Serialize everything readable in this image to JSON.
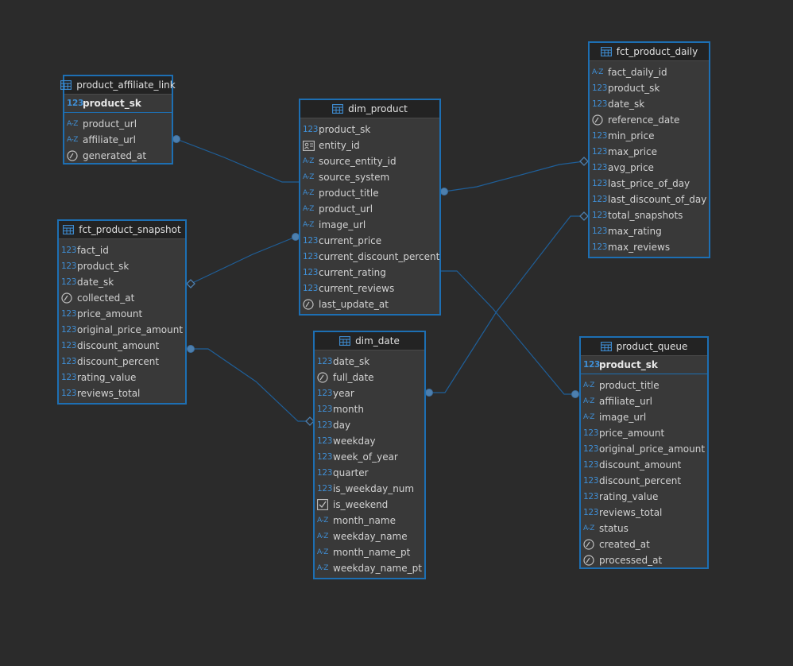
{
  "icons": {
    "number": "123",
    "text": "A-Z",
    "table": "table-icon",
    "date": "clock-icon",
    "identity": "id-card-icon",
    "boolean": "checkbox-icon"
  },
  "colors": {
    "background": "#2b2b2b",
    "border": "#1d6fb3",
    "header": "#232323",
    "connector": "#1f5f99",
    "type_icon": "#3f8fd6"
  },
  "tables": [
    {
      "id": "product_affiliate_link",
      "name": "product_affiliate_link",
      "pk": {
        "name": "product_sk",
        "type": "number"
      },
      "columns": [
        {
          "name": "product_url",
          "type": "text"
        },
        {
          "name": "affiliate_url",
          "type": "text"
        },
        {
          "name": "generated_at",
          "type": "date"
        }
      ]
    },
    {
      "id": "dim_product",
      "name": "dim_product",
      "pk": null,
      "columns": [
        {
          "name": "product_sk",
          "type": "number"
        },
        {
          "name": "entity_id",
          "type": "identity"
        },
        {
          "name": "source_entity_id",
          "type": "text"
        },
        {
          "name": "source_system",
          "type": "text"
        },
        {
          "name": "product_title",
          "type": "text"
        },
        {
          "name": "product_url",
          "type": "text"
        },
        {
          "name": "image_url",
          "type": "text"
        },
        {
          "name": "current_price",
          "type": "number"
        },
        {
          "name": "current_discount_percent",
          "type": "number"
        },
        {
          "name": "current_rating",
          "type": "number"
        },
        {
          "name": "current_reviews",
          "type": "number"
        },
        {
          "name": "last_update_at",
          "type": "date"
        }
      ]
    },
    {
      "id": "fct_product_daily",
      "name": "fct_product_daily",
      "pk": null,
      "columns": [
        {
          "name": "fact_daily_id",
          "type": "text"
        },
        {
          "name": "product_sk",
          "type": "number"
        },
        {
          "name": "date_sk",
          "type": "number"
        },
        {
          "name": "reference_date",
          "type": "date"
        },
        {
          "name": "min_price",
          "type": "number"
        },
        {
          "name": "max_price",
          "type": "number"
        },
        {
          "name": "avg_price",
          "type": "number"
        },
        {
          "name": "last_price_of_day",
          "type": "number"
        },
        {
          "name": "last_discount_of_day",
          "type": "number"
        },
        {
          "name": "total_snapshots",
          "type": "number"
        },
        {
          "name": "max_rating",
          "type": "number"
        },
        {
          "name": "max_reviews",
          "type": "number"
        }
      ]
    },
    {
      "id": "fct_product_snapshot",
      "name": "fct_product_snapshot",
      "pk": null,
      "columns": [
        {
          "name": "fact_id",
          "type": "number"
        },
        {
          "name": "product_sk",
          "type": "number"
        },
        {
          "name": "date_sk",
          "type": "number"
        },
        {
          "name": "collected_at",
          "type": "date"
        },
        {
          "name": "price_amount",
          "type": "number"
        },
        {
          "name": "original_price_amount",
          "type": "number"
        },
        {
          "name": "discount_amount",
          "type": "number"
        },
        {
          "name": "discount_percent",
          "type": "number"
        },
        {
          "name": "rating_value",
          "type": "number"
        },
        {
          "name": "reviews_total",
          "type": "number"
        }
      ]
    },
    {
      "id": "dim_date",
      "name": "dim_date",
      "pk": null,
      "columns": [
        {
          "name": "date_sk",
          "type": "number"
        },
        {
          "name": "full_date",
          "type": "date"
        },
        {
          "name": "year",
          "type": "number"
        },
        {
          "name": "month",
          "type": "number"
        },
        {
          "name": "day",
          "type": "number"
        },
        {
          "name": "weekday",
          "type": "number"
        },
        {
          "name": "week_of_year",
          "type": "number"
        },
        {
          "name": "quarter",
          "type": "number"
        },
        {
          "name": "is_weekday_num",
          "type": "number"
        },
        {
          "name": "is_weekend",
          "type": "boolean"
        },
        {
          "name": "month_name",
          "type": "text"
        },
        {
          "name": "weekday_name",
          "type": "text"
        },
        {
          "name": "month_name_pt",
          "type": "text"
        },
        {
          "name": "weekday_name_pt",
          "type": "text"
        }
      ]
    },
    {
      "id": "product_queue",
      "name": "product_queue",
      "pk": {
        "name": "product_sk",
        "type": "number"
      },
      "columns": [
        {
          "name": "product_title",
          "type": "text"
        },
        {
          "name": "affiliate_url",
          "type": "text"
        },
        {
          "name": "image_url",
          "type": "text"
        },
        {
          "name": "price_amount",
          "type": "number"
        },
        {
          "name": "original_price_amount",
          "type": "number"
        },
        {
          "name": "discount_amount",
          "type": "number"
        },
        {
          "name": "discount_percent",
          "type": "number"
        },
        {
          "name": "rating_value",
          "type": "number"
        },
        {
          "name": "reviews_total",
          "type": "number"
        },
        {
          "name": "status",
          "type": "text"
        },
        {
          "name": "created_at",
          "type": "date"
        },
        {
          "name": "processed_at",
          "type": "date"
        }
      ]
    }
  ]
}
